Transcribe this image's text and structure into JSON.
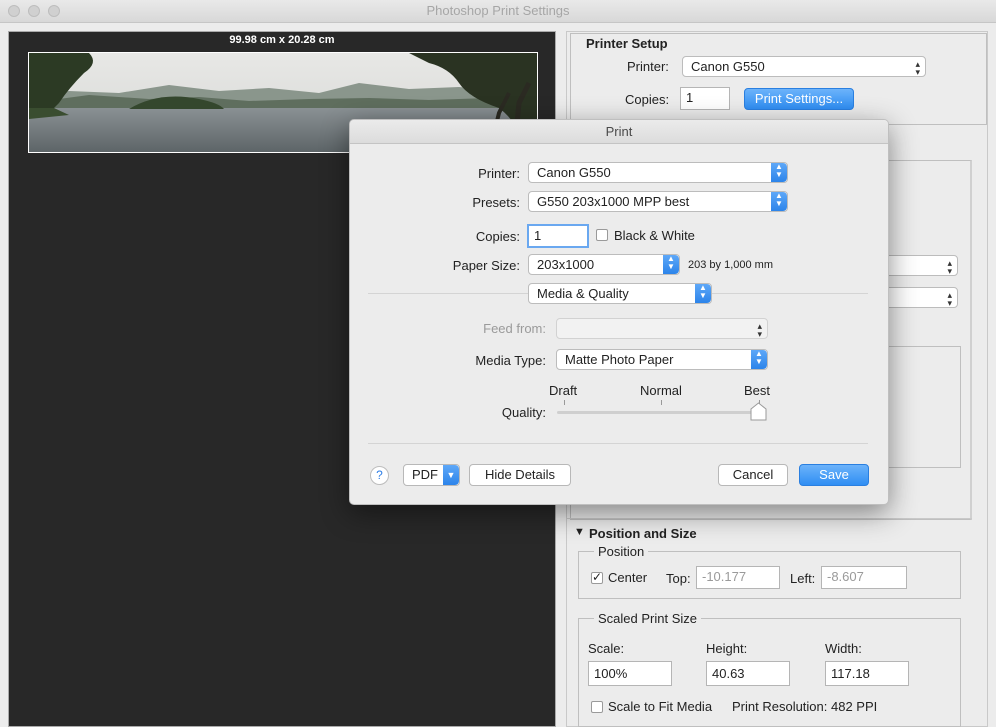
{
  "window": {
    "title": "Photoshop Print Settings"
  },
  "preview": {
    "dimensions": "99.98 cm x 20.28 cm"
  },
  "printer_setup": {
    "heading": "Printer Setup",
    "printer_label": "Printer:",
    "printer_value": "Canon G550",
    "copies_label": "Copies:",
    "copies_value": "1",
    "print_settings_button": "Print Settings..."
  },
  "position_size": {
    "heading": "Position and Size",
    "position_group": "Position",
    "center_label": "Center",
    "top_label": "Top:",
    "top_value": "-10.177",
    "left_label": "Left:",
    "left_value": "-8.607",
    "scaled_group": "Scaled Print Size",
    "scale_label": "Scale:",
    "scale_value": "100%",
    "height_label": "Height:",
    "height_value": "40.63",
    "width_label": "Width:",
    "width_value": "117.18",
    "fit_media_label": "Scale to Fit Media",
    "resolution": "Print Resolution: 482 PPI"
  },
  "print_dialog": {
    "title": "Print",
    "printer_label": "Printer:",
    "printer_value": "Canon G550",
    "presets_label": "Presets:",
    "presets_value": "G550 203x1000 MPP best",
    "copies_label": "Copies:",
    "copies_value": "1",
    "bw_label": "Black & White",
    "paper_size_label": "Paper Size:",
    "paper_size_value": "203x1000",
    "paper_size_desc": "203 by 1,000 mm",
    "section_value": "Media & Quality",
    "feed_from_label": "Feed from:",
    "feed_from_value": "",
    "media_type_label": "Media Type:",
    "media_type_value": "Matte Photo Paper",
    "quality_label": "Quality:",
    "quality_ticks": [
      "Draft",
      "Normal",
      "Best"
    ],
    "quality_level": "Best",
    "help_label": "?",
    "pdf_label": "PDF",
    "hide_details": "Hide Details",
    "cancel": "Cancel",
    "save": "Save"
  },
  "colors": {
    "accent": "#2f8ef3",
    "preview_bg": "#282828"
  }
}
